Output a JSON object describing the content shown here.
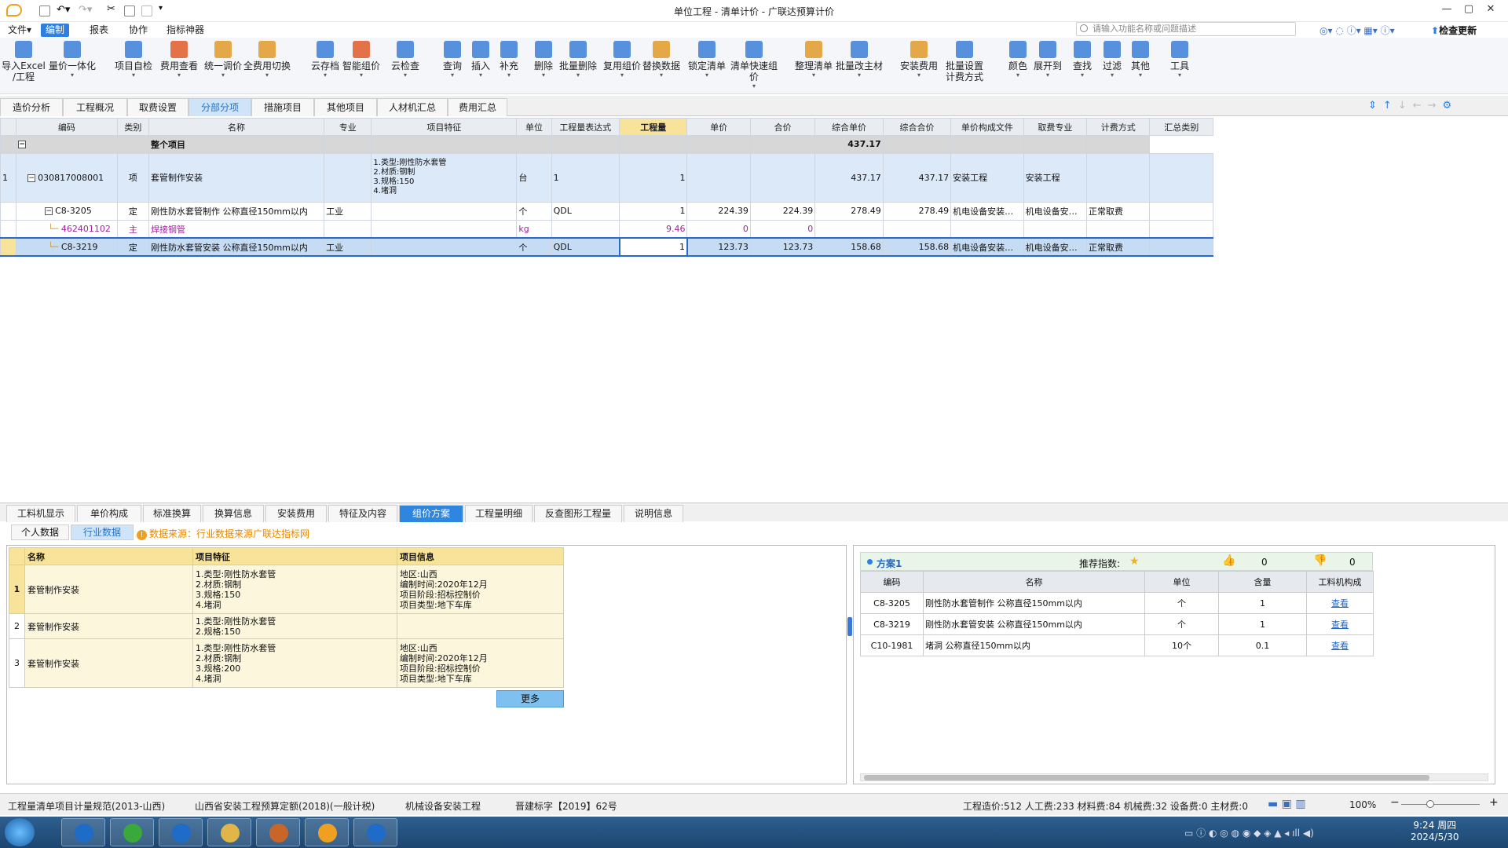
{
  "window": {
    "title": "单位工程 - 清单计价 - 广联达预算计价",
    "controls": [
      "—",
      "▢",
      "✕"
    ]
  },
  "menu": {
    "items": [
      "文件▾",
      "编制",
      "报表",
      "协作",
      "指标神器"
    ],
    "active": 1,
    "search_placeholder": "请输入功能名称或问题描述",
    "check_update": "检查更新"
  },
  "ribbon": [
    {
      "label": "导入Excel",
      "label2": "/工程",
      "icon": "import-excel-icon",
      "color": "#3b7fd8"
    },
    {
      "label": "量价一体化",
      "icon": "quantity-price-icon",
      "color": "#3b7fd8"
    },
    {
      "label": "项目自检",
      "icon": "self-check-icon",
      "color": "#3b7fd8"
    },
    {
      "label": "费用查看",
      "icon": "fee-view-icon",
      "color": "#e05b2a"
    },
    {
      "label": "统一调价",
      "icon": "unify-price-icon",
      "color": "#e09a2a"
    },
    {
      "label": "全费用切换",
      "icon": "full-fee-icon",
      "color": "#e09a2a"
    },
    {
      "label": "云存档",
      "icon": "cloud-save-icon",
      "color": "#3b7fd8"
    },
    {
      "label": "智能组价",
      "icon": "smart-price-icon",
      "color": "#e05b2a"
    },
    {
      "label": "云检查",
      "icon": "cloud-check-icon",
      "color": "#3b7fd8"
    },
    {
      "label": "查询",
      "icon": "query-icon",
      "color": "#3b7fd8"
    },
    {
      "label": "插入",
      "icon": "insert-icon",
      "color": "#3b7fd8"
    },
    {
      "label": "补充",
      "icon": "supplement-icon",
      "color": "#3b7fd8"
    },
    {
      "label": "删除",
      "icon": "delete-icon",
      "color": "#3b7fd8"
    },
    {
      "label": "批量删除",
      "icon": "batch-delete-icon",
      "color": "#3b7fd8"
    },
    {
      "label": "复用组价",
      "icon": "reuse-price-icon",
      "color": "#3b7fd8"
    },
    {
      "label": "替换数据",
      "icon": "replace-data-icon",
      "color": "#e09a2a"
    },
    {
      "label": "锁定清单",
      "icon": "lock-list-icon",
      "color": "#3b7fd8"
    },
    {
      "label": "清单快速组价",
      "icon": "quick-price-icon",
      "color": "#3b7fd8"
    },
    {
      "label": "整理清单",
      "icon": "arrange-list-icon",
      "color": "#e09a2a"
    },
    {
      "label": "批量改主材",
      "icon": "batch-material-icon",
      "color": "#3b7fd8"
    },
    {
      "label": "安装费用",
      "icon": "install-fee-icon",
      "color": "#e09a2a"
    },
    {
      "label": "批量设置",
      "label2": "计费方式",
      "icon": "batch-setting-icon",
      "color": "#3b7fd8"
    },
    {
      "label": "颜色",
      "icon": "color-icon",
      "color": "#3b7fd8"
    },
    {
      "label": "展开到",
      "icon": "expand-to-icon",
      "color": "#3b7fd8"
    },
    {
      "label": "查找",
      "icon": "find-icon",
      "color": "#3b7fd8"
    },
    {
      "label": "过滤",
      "icon": "filter-icon",
      "color": "#3b7fd8"
    },
    {
      "label": "其他",
      "icon": "other-icon",
      "color": "#3b7fd8"
    },
    {
      "label": "工具",
      "icon": "tools-icon",
      "color": "#3b7fd8"
    }
  ],
  "top_tabs": [
    "造价分析",
    "工程概况",
    "取费设置",
    "分部分项",
    "措施项目",
    "其他项目",
    "人材机汇总",
    "费用汇总"
  ],
  "top_tab_active": 3,
  "grid": {
    "columns": [
      "编码",
      "类别",
      "名称",
      "专业",
      "项目特征",
      "单位",
      "工程量表达式",
      "工程量",
      "单价",
      "合价",
      "综合单价",
      "综合合价",
      "单价构成文件",
      "取费专业",
      "计费方式",
      "汇总类别"
    ],
    "total_row": {
      "name": "整个项目",
      "total": "437.17"
    },
    "rows": [
      {
        "idx": "1",
        "code": "030817008001",
        "type": "项",
        "name": "套管制作安装",
        "major": "",
        "feature": [
          "1.类型:刚性防水套管",
          "2.材质:钢制",
          "3.规格:150",
          "4.堵洞"
        ],
        "unit": "台",
        "expr": "1",
        "qty": "1",
        "price": "",
        "amount": "",
        "uprice": "437.17",
        "uamount": "437.17",
        "file": "安装工程",
        "feemajor": "安装工程",
        "method": "",
        "cat": ""
      },
      {
        "idx": "",
        "code": "C8-3205",
        "type": "定",
        "name": "刚性防水套管制作 公称直径150mm以内",
        "major": "工业",
        "feature": [],
        "unit": "个",
        "expr": "QDL",
        "qty": "1",
        "price": "224.39",
        "amount": "224.39",
        "uprice": "278.49",
        "uamount": "278.49",
        "file": "机电设备安装…",
        "feemajor": "机电设备安…",
        "method": "正常取费",
        "cat": ""
      },
      {
        "idx": "",
        "code": "462401102",
        "type": "主",
        "name": "焊接钢管",
        "major": "",
        "feature": [],
        "unit": "kg",
        "expr": "",
        "qty": "9.46",
        "price": "0",
        "amount": "0",
        "uprice": "",
        "uamount": "",
        "file": "",
        "feemajor": "",
        "method": "",
        "cat": ""
      },
      {
        "idx": "",
        "code": "C8-3219",
        "type": "定",
        "name": "刚性防水套管安装 公称直径150mm以内",
        "major": "工业",
        "feature": [],
        "unit": "个",
        "expr": "QDL",
        "qty": "1",
        "price": "123.73",
        "amount": "123.73",
        "uprice": "158.68",
        "uamount": "158.68",
        "file": "机电设备安装…",
        "feemajor": "机电设备安…",
        "method": "正常取费",
        "cat": ""
      }
    ]
  },
  "bottom_tabs": [
    "工料机显示",
    "单价构成",
    "标准换算",
    "换算信息",
    "安装费用",
    "特征及内容",
    "组价方案",
    "工程量明细",
    "反查图形工程量",
    "说明信息"
  ],
  "bottom_tab_active": 6,
  "sub_tabs": [
    "个人数据",
    "行业数据"
  ],
  "sub_tab_active": 1,
  "notice": "数据来源：行业数据来源广联达指标网",
  "left_table": {
    "columns": [
      "名称",
      "项目特征",
      "项目信息"
    ],
    "rows": [
      {
        "idx": "1",
        "name": "套管制作安装",
        "feature": [
          "1.类型:刚性防水套管",
          "2.材质:钢制",
          "3.规格:150",
          "4.堵洞"
        ],
        "info": [
          "地区:山西",
          "编制时间:2020年12月",
          "项目阶段:招标控制价",
          "项目类型:地下车库"
        ]
      },
      {
        "idx": "2",
        "name": "套管制作安装",
        "feature": [
          "1.类型:刚性防水套管",
          "2.规格:150"
        ],
        "info": []
      },
      {
        "idx": "3",
        "name": "套管制作安装",
        "feature": [
          "1.类型:刚性防水套管",
          "2.材质:钢制",
          "3.规格:200",
          "4.堵洞"
        ],
        "info": [
          "地区:山西",
          "编制时间:2020年12月",
          "项目阶段:招标控制价",
          "项目类型:地下车库"
        ]
      }
    ],
    "more": "更多"
  },
  "right_panel": {
    "plan": "方案1",
    "recommend": "推荐指数:",
    "likes": "0",
    "dislikes": "0",
    "columns": [
      "编码",
      "名称",
      "单位",
      "含量",
      "工料机构成"
    ],
    "rows": [
      {
        "code": "C8-3205",
        "name": "刚性防水套管制作 公称直径150mm以内",
        "unit": "个",
        "qty": "1",
        "link": "查看"
      },
      {
        "code": "C8-3219",
        "name": "刚性防水套管安装 公称直径150mm以内",
        "unit": "个",
        "qty": "1",
        "link": "查看"
      },
      {
        "code": "C10-1981",
        "name": "堵洞 公称直径150mm以内",
        "unit": "10个",
        "qty": "0.1",
        "link": "查看"
      }
    ]
  },
  "status": {
    "left": [
      "工程量清单项目计量规范(2013-山西)",
      "山西省安装工程预算定额(2018)(一般计税)",
      "机械设备安装工程",
      "晋建标字【2019】62号"
    ],
    "right": "工程造价:512  人工费:233  材料费:84  机械费:32  设备费:0  主材费:0",
    "zoom": "100%"
  },
  "taskbar": {
    "time": "9:24 周四",
    "date": "2024/5/30",
    "apps": [
      "#1e6cc8",
      "#3aa83a",
      "#1e6cc8",
      "#e0b64a",
      "#c8662a",
      "#f0a020",
      "#1e6cc8"
    ]
  }
}
